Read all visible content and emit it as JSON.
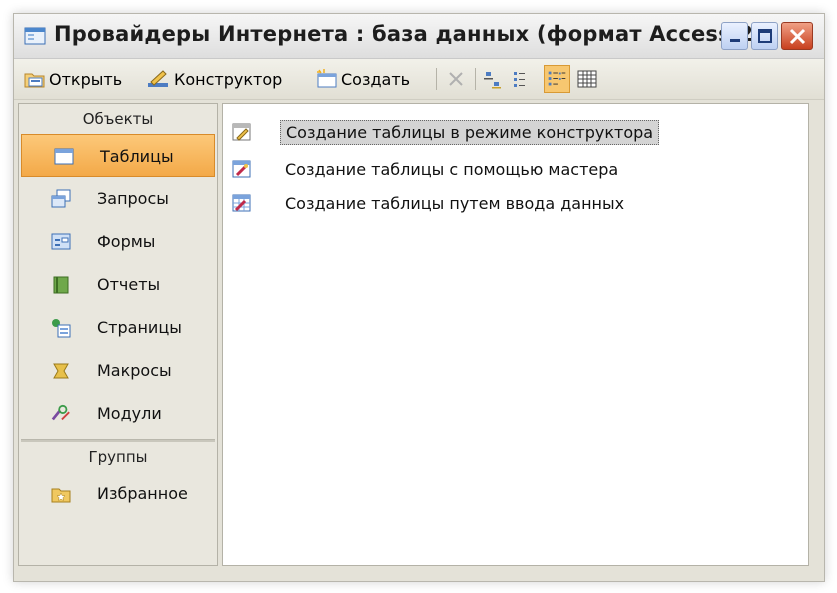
{
  "window": {
    "title": "Провайдеры Интернета : база данных (формат Access 2...",
    "icon": "database-window-icon",
    "controls": [
      "minimize-icon",
      "maximize-icon",
      "close-icon"
    ]
  },
  "toolbar": {
    "open_label": "Открыть",
    "design_label": "Конструктор",
    "create_label": "Создать",
    "tools": [
      "delete-icon",
      "large-icons-icon",
      "small-icons-icon",
      "list-view-icon",
      "details-view-icon"
    ],
    "active_view": "list-view-icon"
  },
  "sidebar": {
    "objects_header": "Объекты",
    "items": [
      {
        "label": "Таблицы",
        "icon": "table-icon",
        "selected": true
      },
      {
        "label": "Запросы",
        "icon": "query-icon"
      },
      {
        "label": "Формы",
        "icon": "form-icon"
      },
      {
        "label": "Отчеты",
        "icon": "report-icon"
      },
      {
        "label": "Страницы",
        "icon": "page-icon"
      },
      {
        "label": "Макросы",
        "icon": "macro-icon"
      },
      {
        "label": "Модули",
        "icon": "module-icon"
      }
    ],
    "groups_header": "Группы",
    "groups": [
      {
        "label": "Избранное",
        "icon": "favorites-folder-icon"
      }
    ]
  },
  "main": {
    "items": [
      {
        "label": "Создание таблицы в режиме конструктора",
        "icon": "design-wizard-icon",
        "selected": true
      },
      {
        "label": "Создание таблицы с помощью мастера",
        "icon": "wizard-icon"
      },
      {
        "label": "Создание таблицы путем ввода данных",
        "icon": "datasheet-wizard-icon"
      }
    ]
  },
  "colors": {
    "selection": "#f3a948",
    "window_bg": "#e4e2d8",
    "close_button": "#c8401f"
  }
}
